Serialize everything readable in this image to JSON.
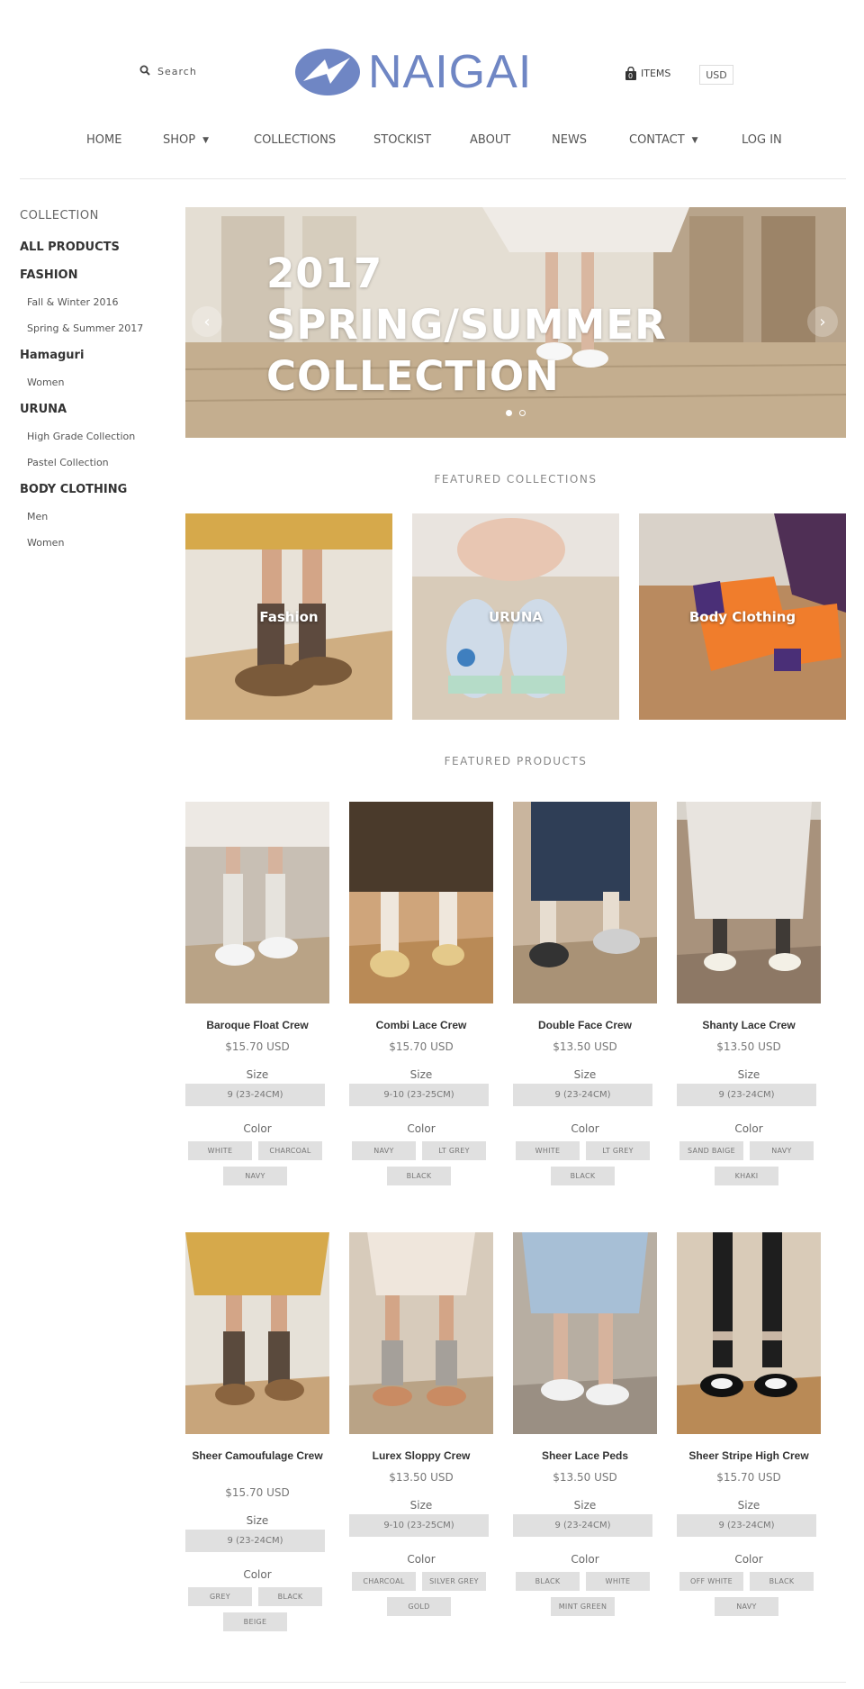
{
  "header": {
    "search_label": "Search",
    "logo_text": "NAIGAI",
    "cart_count": "0",
    "cart_label": "ITEMS",
    "currency": "USD"
  },
  "nav": {
    "items": [
      {
        "label": "HOME"
      },
      {
        "label": "SHOP"
      },
      {
        "label": "COLLECTIONS"
      },
      {
        "label": "STOCKIST"
      },
      {
        "label": "ABOUT"
      },
      {
        "label": "NEWS"
      },
      {
        "label": "CONTACT"
      },
      {
        "label": "LOG IN"
      }
    ]
  },
  "sidebar": {
    "title": "COLLECTION",
    "items": [
      {
        "label": "ALL PRODUCTS"
      },
      {
        "label": "FASHION"
      },
      {
        "label": "Fall & Winter 2016"
      },
      {
        "label": "Spring & Summer 2017"
      },
      {
        "label": "Hamaguri"
      },
      {
        "label": "Women"
      },
      {
        "label": "URUNA"
      },
      {
        "label": "High Grade Collection"
      },
      {
        "label": "Pastel Collection"
      },
      {
        "label": "BODY CLOTHING"
      },
      {
        "label": "Men"
      },
      {
        "label": "Women"
      }
    ]
  },
  "slider": {
    "line1": "2017",
    "line2": "SPRING/SUMMER",
    "line3": "COLLECTION",
    "prev_icon": "chevron-left-icon",
    "next_icon": "chevron-right-icon",
    "slide_count": 2,
    "active_slide": 1
  },
  "featured_collections": {
    "title": "FEATURED COLLECTIONS",
    "items": [
      {
        "label": "Fashion"
      },
      {
        "label": "URUNA"
      },
      {
        "label": "Body Clothing"
      }
    ]
  },
  "featured_products": {
    "title": "FEATURED PRODUCTS",
    "size_label": "Size",
    "color_label": "Color",
    "items": [
      {
        "name": "Baroque Float Crew",
        "price": "$15.70 USD",
        "size": "9 (23-24CM)",
        "colors": [
          "WHITE",
          "CHARCOAL",
          "NAVY"
        ]
      },
      {
        "name": "Combi Lace Crew",
        "price": "$15.70 USD",
        "size": "9-10 (23-25CM)",
        "colors": [
          "NAVY",
          "LT GREY",
          "BLACK"
        ]
      },
      {
        "name": "Double Face Crew",
        "price": "$13.50 USD",
        "size": "9 (23-24CM)",
        "colors": [
          "WHITE",
          "LT GREY",
          "BLACK"
        ]
      },
      {
        "name": "Shanty Lace Crew",
        "price": "$13.50 USD",
        "size": "9 (23-24CM)",
        "colors": [
          "SAND BAIGE",
          "NAVY",
          "KHAKI"
        ]
      },
      {
        "name": "Sheer Camoufulage Crew",
        "price": "$15.70 USD",
        "size": "9 (23-24CM)",
        "colors": [
          "GREY",
          "BLACK",
          "BEIGE"
        ]
      },
      {
        "name": "Lurex Sloppy Crew",
        "price": "$13.50 USD",
        "size": "9-10 (23-25CM)",
        "colors": [
          "CHARCOAL",
          "SILVER GREY",
          "GOLD"
        ]
      },
      {
        "name": "Sheer Lace Peds",
        "price": "$13.50 USD",
        "size": "9 (23-24CM)",
        "colors": [
          "BLACK",
          "WHITE",
          "MINT GREEN"
        ]
      },
      {
        "name": "Sheer Stripe High Crew",
        "price": "$15.70 USD",
        "size": "9 (23-24CM)",
        "colors": [
          "OFF WHITE",
          "BLACK",
          "NAVY"
        ]
      }
    ]
  },
  "colors": {
    "brand_blue": "#6f86c4",
    "swatch_bg": "#e0e0e0"
  }
}
